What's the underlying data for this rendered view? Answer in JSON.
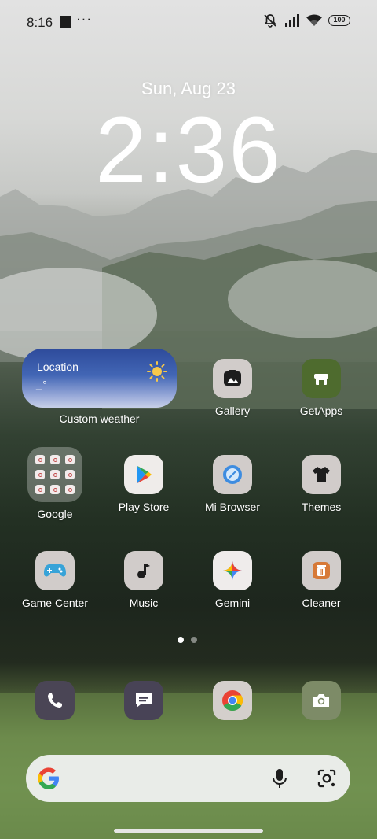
{
  "status_bar": {
    "time": "8:16",
    "more": "···",
    "battery": "100",
    "icons": [
      "notification-square-icon",
      "mute-icon",
      "signal-icon",
      "wifi-icon",
      "battery-icon"
    ]
  },
  "lockscreen_clock": {
    "date": "Sun, Aug 23",
    "time": "2:36"
  },
  "weather_widget": {
    "location": "Location",
    "temperature": "_°",
    "label": "Custom weather",
    "icon": "sun-icon"
  },
  "apps": [
    {
      "label": "Gallery",
      "icon": "gallery-icon"
    },
    {
      "label": "GetApps",
      "icon": "getapps-icon"
    },
    {
      "label": "Google",
      "icon": "folder-icon"
    },
    {
      "label": "Play Store",
      "icon": "play-store-icon"
    },
    {
      "label": "Mi Browser",
      "icon": "browser-icon"
    },
    {
      "label": "Themes",
      "icon": "themes-icon"
    },
    {
      "label": "Game Center",
      "icon": "gamepad-icon"
    },
    {
      "label": "Music",
      "icon": "music-icon"
    },
    {
      "label": "Gemini",
      "icon": "gemini-icon"
    },
    {
      "label": "Cleaner",
      "icon": "trash-icon"
    }
  ],
  "page_indicator": {
    "pages": 2,
    "active": 1
  },
  "dock": [
    "phone-icon",
    "messages-icon",
    "chrome-icon",
    "camera-icon"
  ],
  "search_bar": {
    "icons": [
      "google-g-icon",
      "microphone-icon",
      "lens-icon"
    ]
  },
  "colors": {
    "getapps": "#4e6b2e",
    "weather_top": "#2e4b9b",
    "dock_phone": "#4a4555",
    "dock_camera": "#7d8b67"
  }
}
